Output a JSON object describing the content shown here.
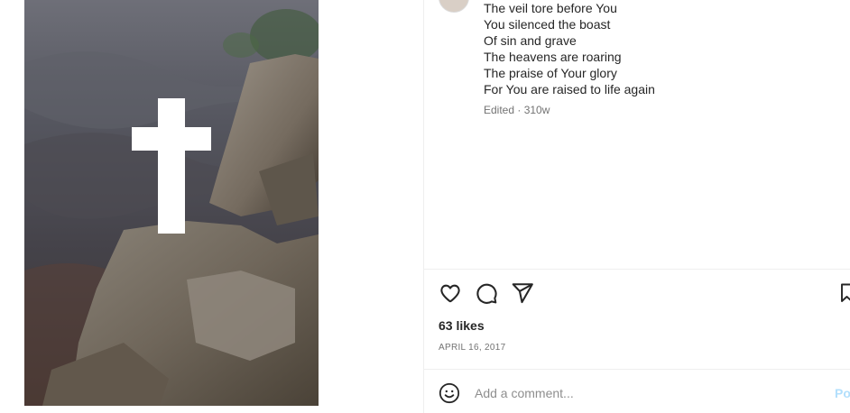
{
  "caption": {
    "lines": [
      "The veil tore before You",
      "You silenced the boast",
      "Of sin and grave",
      "The heavens are roaring",
      "The praise of Your glory",
      "For You are raised to life again"
    ]
  },
  "meta": {
    "edited_label": "Edited",
    "separator": " · ",
    "age": "310w"
  },
  "post": {
    "likes": "63 likes",
    "date": "APRIL 16, 2017",
    "image_description_icon": "cross-on-rocks-photo"
  },
  "actions": {
    "like_icon": "heart-icon",
    "comment_icon": "comment-icon",
    "share_icon": "send-icon",
    "save_icon": "bookmark-icon"
  },
  "comment_box": {
    "placeholder": "Add a comment...",
    "post_label": "Post"
  },
  "colors": {
    "text": "#262626",
    "muted": "#737373",
    "divider": "#efefef",
    "post_disabled": "#b2dffc"
  }
}
